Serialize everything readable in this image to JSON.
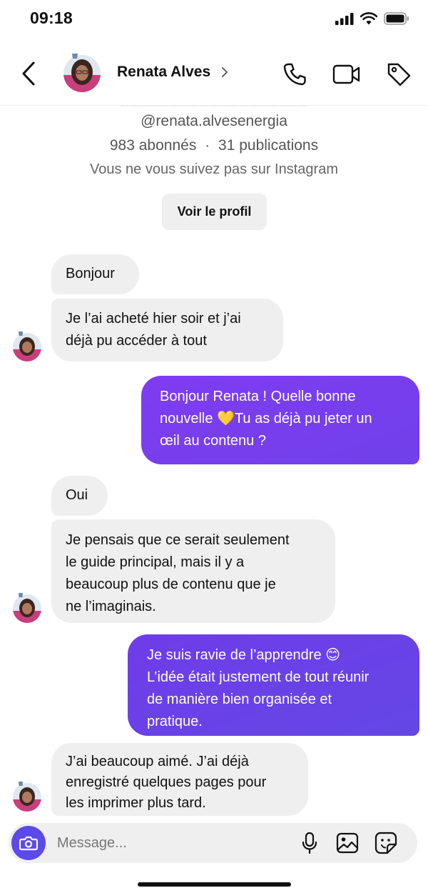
{
  "status_bar": {
    "time": "09:18"
  },
  "header": {
    "contact_name": "Renata Alves"
  },
  "profile": {
    "handle": "@renata.alvesenergia",
    "followers": "983 abonnés",
    "separator": "·",
    "posts": "31 publications",
    "follow_note": "Vous ne vous suivez pas sur Instagram",
    "view_profile_label": "Voir le profil"
  },
  "messages": [
    {
      "from": "them",
      "text": "Bonjour"
    },
    {
      "from": "them",
      "lines": [
        "Je l’ai acheté hier soir et j’ai",
        "déjà pu accéder à tout"
      ]
    },
    {
      "from": "me",
      "lines": [
        "Bonjour Renata ! Quelle bonne",
        "nouvelle 💛Tu as déjà pu jeter un",
        "œil au contenu ?"
      ]
    },
    {
      "from": "them",
      "text": "Oui"
    },
    {
      "from": "them",
      "lines": [
        "Je pensais que ce serait seulement",
        "le guide principal, mais il y a",
        "beaucoup plus de contenu que je",
        "ne l’imaginais."
      ]
    },
    {
      "from": "me",
      "lines": [
        "Je suis ravie de l’apprendre 😊",
        "L’idée était justement de tout réunir",
        "de manière bien organisée et",
        "pratique."
      ]
    },
    {
      "from": "them",
      "lines": [
        "J’ai beaucoup aimé. J’ai déjà",
        "enregistré quelques pages pour",
        "les imprimer plus tard."
      ]
    }
  ],
  "composer": {
    "placeholder": "Message..."
  },
  "colors": {
    "outgoing_bubble": "#7a3df0",
    "incoming_bubble": "#efefef",
    "camera_button": "#5b4ae8"
  }
}
